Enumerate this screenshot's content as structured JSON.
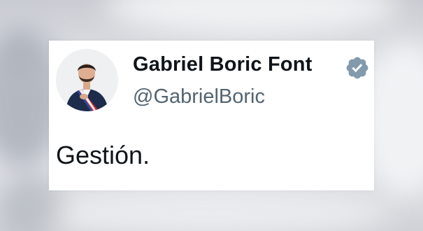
{
  "tweet": {
    "display_name": "Gabriel Boric Font",
    "handle": "@GabrielBoric",
    "text": "Gestión.",
    "verified": true,
    "avatar_icon": "profile-photo",
    "verified_icon": "verified-badge-icon"
  },
  "colors": {
    "name": "#0f1419",
    "handle": "#536471",
    "badge": "#829aab",
    "card": "#ffffff"
  }
}
